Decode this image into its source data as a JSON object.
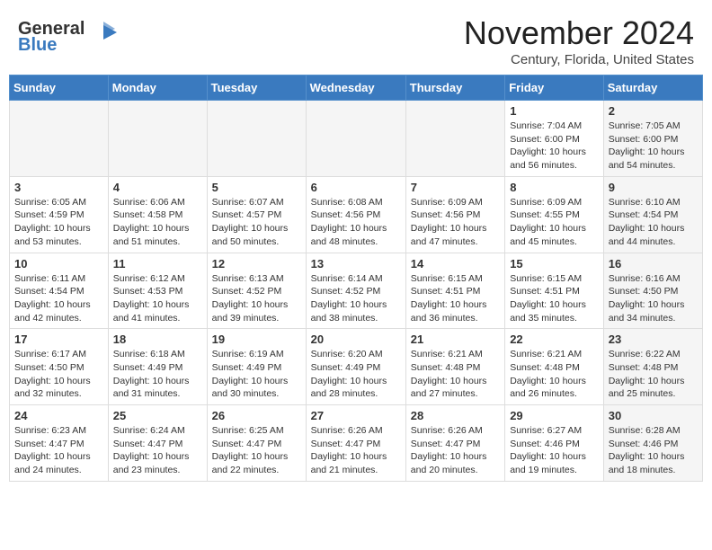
{
  "header": {
    "logo_general": "General",
    "logo_blue": "Blue",
    "month_title": "November 2024",
    "location": "Century, Florida, United States"
  },
  "weekdays": [
    "Sunday",
    "Monday",
    "Tuesday",
    "Wednesday",
    "Thursday",
    "Friday",
    "Saturday"
  ],
  "rows": [
    [
      {
        "day": "",
        "info": "",
        "gray": true
      },
      {
        "day": "",
        "info": "",
        "gray": true
      },
      {
        "day": "",
        "info": "",
        "gray": true
      },
      {
        "day": "",
        "info": "",
        "gray": true
      },
      {
        "day": "",
        "info": "",
        "gray": true
      },
      {
        "day": "1",
        "info": "Sunrise: 7:04 AM\nSunset: 6:00 PM\nDaylight: 10 hours\nand 56 minutes.",
        "gray": false
      },
      {
        "day": "2",
        "info": "Sunrise: 7:05 AM\nSunset: 6:00 PM\nDaylight: 10 hours\nand 54 minutes.",
        "gray": true
      }
    ],
    [
      {
        "day": "3",
        "info": "Sunrise: 6:05 AM\nSunset: 4:59 PM\nDaylight: 10 hours\nand 53 minutes.",
        "gray": false
      },
      {
        "day": "4",
        "info": "Sunrise: 6:06 AM\nSunset: 4:58 PM\nDaylight: 10 hours\nand 51 minutes.",
        "gray": false
      },
      {
        "day": "5",
        "info": "Sunrise: 6:07 AM\nSunset: 4:57 PM\nDaylight: 10 hours\nand 50 minutes.",
        "gray": false
      },
      {
        "day": "6",
        "info": "Sunrise: 6:08 AM\nSunset: 4:56 PM\nDaylight: 10 hours\nand 48 minutes.",
        "gray": false
      },
      {
        "day": "7",
        "info": "Sunrise: 6:09 AM\nSunset: 4:56 PM\nDaylight: 10 hours\nand 47 minutes.",
        "gray": false
      },
      {
        "day": "8",
        "info": "Sunrise: 6:09 AM\nSunset: 4:55 PM\nDaylight: 10 hours\nand 45 minutes.",
        "gray": false
      },
      {
        "day": "9",
        "info": "Sunrise: 6:10 AM\nSunset: 4:54 PM\nDaylight: 10 hours\nand 44 minutes.",
        "gray": true
      }
    ],
    [
      {
        "day": "10",
        "info": "Sunrise: 6:11 AM\nSunset: 4:54 PM\nDaylight: 10 hours\nand 42 minutes.",
        "gray": false
      },
      {
        "day": "11",
        "info": "Sunrise: 6:12 AM\nSunset: 4:53 PM\nDaylight: 10 hours\nand 41 minutes.",
        "gray": false
      },
      {
        "day": "12",
        "info": "Sunrise: 6:13 AM\nSunset: 4:52 PM\nDaylight: 10 hours\nand 39 minutes.",
        "gray": false
      },
      {
        "day": "13",
        "info": "Sunrise: 6:14 AM\nSunset: 4:52 PM\nDaylight: 10 hours\nand 38 minutes.",
        "gray": false
      },
      {
        "day": "14",
        "info": "Sunrise: 6:15 AM\nSunset: 4:51 PM\nDaylight: 10 hours\nand 36 minutes.",
        "gray": false
      },
      {
        "day": "15",
        "info": "Sunrise: 6:15 AM\nSunset: 4:51 PM\nDaylight: 10 hours\nand 35 minutes.",
        "gray": false
      },
      {
        "day": "16",
        "info": "Sunrise: 6:16 AM\nSunset: 4:50 PM\nDaylight: 10 hours\nand 34 minutes.",
        "gray": true
      }
    ],
    [
      {
        "day": "17",
        "info": "Sunrise: 6:17 AM\nSunset: 4:50 PM\nDaylight: 10 hours\nand 32 minutes.",
        "gray": false
      },
      {
        "day": "18",
        "info": "Sunrise: 6:18 AM\nSunset: 4:49 PM\nDaylight: 10 hours\nand 31 minutes.",
        "gray": false
      },
      {
        "day": "19",
        "info": "Sunrise: 6:19 AM\nSunset: 4:49 PM\nDaylight: 10 hours\nand 30 minutes.",
        "gray": false
      },
      {
        "day": "20",
        "info": "Sunrise: 6:20 AM\nSunset: 4:49 PM\nDaylight: 10 hours\nand 28 minutes.",
        "gray": false
      },
      {
        "day": "21",
        "info": "Sunrise: 6:21 AM\nSunset: 4:48 PM\nDaylight: 10 hours\nand 27 minutes.",
        "gray": false
      },
      {
        "day": "22",
        "info": "Sunrise: 6:21 AM\nSunset: 4:48 PM\nDaylight: 10 hours\nand 26 minutes.",
        "gray": false
      },
      {
        "day": "23",
        "info": "Sunrise: 6:22 AM\nSunset: 4:48 PM\nDaylight: 10 hours\nand 25 minutes.",
        "gray": true
      }
    ],
    [
      {
        "day": "24",
        "info": "Sunrise: 6:23 AM\nSunset: 4:47 PM\nDaylight: 10 hours\nand 24 minutes.",
        "gray": false
      },
      {
        "day": "25",
        "info": "Sunrise: 6:24 AM\nSunset: 4:47 PM\nDaylight: 10 hours\nand 23 minutes.",
        "gray": false
      },
      {
        "day": "26",
        "info": "Sunrise: 6:25 AM\nSunset: 4:47 PM\nDaylight: 10 hours\nand 22 minutes.",
        "gray": false
      },
      {
        "day": "27",
        "info": "Sunrise: 6:26 AM\nSunset: 4:47 PM\nDaylight: 10 hours\nand 21 minutes.",
        "gray": false
      },
      {
        "day": "28",
        "info": "Sunrise: 6:26 AM\nSunset: 4:47 PM\nDaylight: 10 hours\nand 20 minutes.",
        "gray": false
      },
      {
        "day": "29",
        "info": "Sunrise: 6:27 AM\nSunset: 4:46 PM\nDaylight: 10 hours\nand 19 minutes.",
        "gray": false
      },
      {
        "day": "30",
        "info": "Sunrise: 6:28 AM\nSunset: 4:46 PM\nDaylight: 10 hours\nand 18 minutes.",
        "gray": true
      }
    ]
  ]
}
